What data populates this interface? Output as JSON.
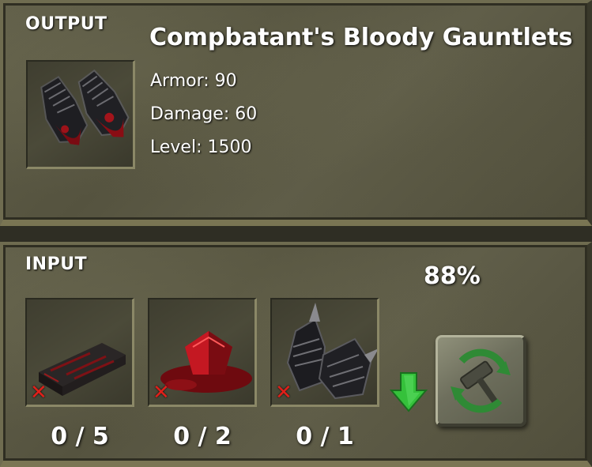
{
  "output": {
    "title": "OUTPUT",
    "item_name": "Compbatant's Bloody Gauntlets",
    "stats": [
      {
        "label": "Armor: 90"
      },
      {
        "label": "Damage: 60"
      },
      {
        "label": "Level: 1500"
      }
    ],
    "item_icon": "bloody-gauntlets-icon"
  },
  "input": {
    "title": "INPUT",
    "success_chance": "88%",
    "ingredients": [
      {
        "icon": "bloody-ingot-icon",
        "count": "0 / 5",
        "missing": true
      },
      {
        "icon": "blood-gem-icon",
        "count": "0 / 2",
        "missing": true
      },
      {
        "icon": "spiked-gauntlets-icon",
        "count": "0 / 1",
        "missing": true
      }
    ],
    "craft_button_icon": "hammer-craft-icon",
    "arrow_icon": "green-down-arrow-icon"
  },
  "colors": {
    "panel": "#5a5844",
    "missing_mark": "#e0201a",
    "arrow": "#35c13b",
    "craft_accent": "#2f8a35"
  }
}
